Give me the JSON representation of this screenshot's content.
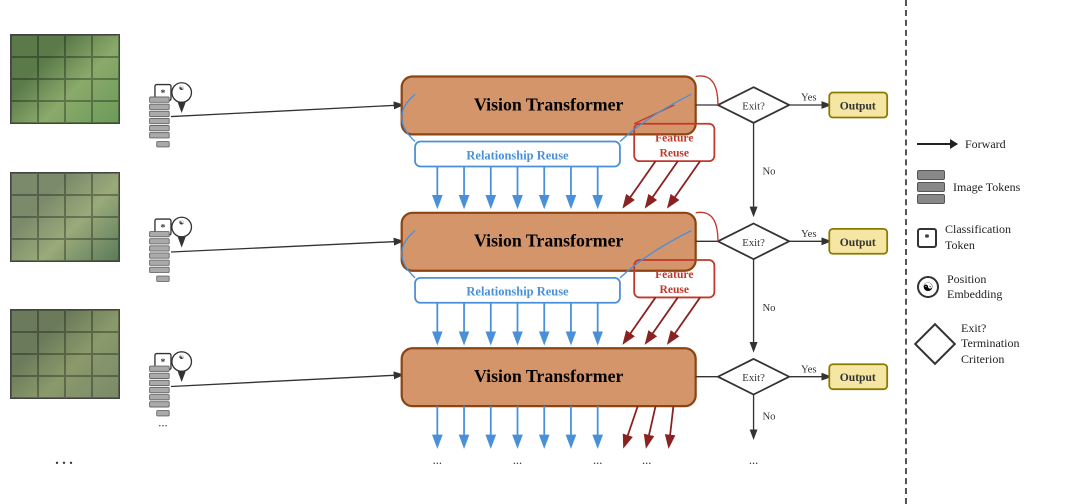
{
  "legend": {
    "forward_label": "Forward",
    "image_tokens_label": "Image Tokens",
    "cls_token_label": "Classification\nToken",
    "pos_emb_label": "Position\nEmbedding",
    "exit_label": "Exit?\nTermination\nCriterion"
  },
  "blocks": [
    {
      "id": "vit1",
      "label": "Vision Transformer",
      "rel_label": "Relationship Reuse",
      "feat_label": "Feature\nReuse"
    },
    {
      "id": "vit2",
      "label": "Vision Transformer",
      "rel_label": "Relationship Reuse",
      "feat_label": "Feature\nReuse"
    },
    {
      "id": "vit3",
      "label": "Vision Transformer"
    }
  ],
  "exit_labels": [
    "Exit?",
    "Exit?",
    "Exit?"
  ],
  "yes_labels": [
    "Yes",
    "Yes",
    "Yes"
  ],
  "no_labels": [
    "No",
    "No",
    "No"
  ],
  "output_labels": [
    "Output",
    "Output",
    "Output"
  ],
  "dots": {
    "bottom": "...",
    "image_dots": "..."
  },
  "colors": {
    "vit_fill": "#d4956b",
    "vit_stroke": "#8b4513",
    "rel_stroke": "#4a90d9",
    "feat_stroke": "#c0392b",
    "arrow_blue": "#4a90d9",
    "arrow_dark_red": "#8b2222",
    "exit_fill": "#fff",
    "output_fill": "#f5e6a3",
    "output_stroke": "#8b7a00"
  }
}
